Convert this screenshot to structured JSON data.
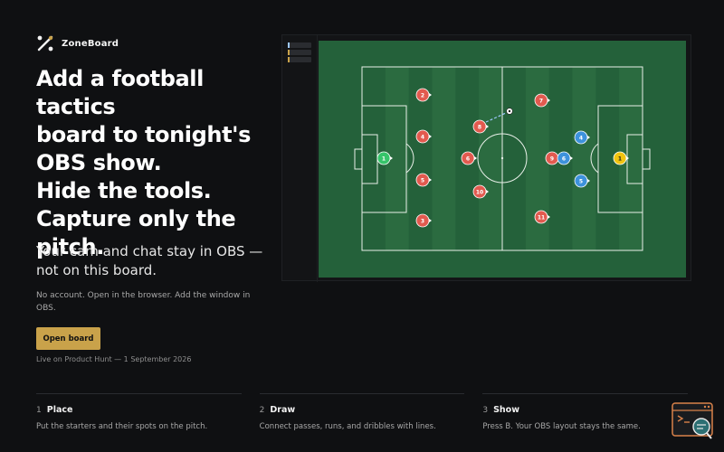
{
  "brand": {
    "name": "ZoneBoard",
    "logo_icon": "zone-logo-icon"
  },
  "hero": {
    "title_lines": [
      "Add a football tactics",
      "board to tonight's",
      "OBS show.",
      "Hide the tools.",
      "Capture only the",
      "pitch."
    ],
    "subtitle": "Your cam and chat stay in OBS — not on this board.",
    "note": "No account. Open in the browser. Add the window in OBS.",
    "cta_label": "Open board",
    "launch_text": "Live on Product Hunt — 1 September 2026"
  },
  "board": {
    "tools": [
      {
        "name": "tool-1",
        "accent": "#9ec9ff"
      },
      {
        "name": "tool-2",
        "accent": "#c9a24a"
      },
      {
        "name": "tool-3",
        "accent": "#c9a24a"
      }
    ],
    "colors": {
      "pitch": "#24613a",
      "stripe": "#2b6b40",
      "line": "#e8efe8",
      "red": "#e25a4f",
      "blue": "#3d92dc",
      "green": "#36c46a",
      "yellow": "#f1c40f"
    },
    "players": [
      {
        "label": "1",
        "team": "green"
      },
      {
        "label": "2",
        "team": "red"
      },
      {
        "label": "4",
        "team": "red"
      },
      {
        "label": "5",
        "team": "red"
      },
      {
        "label": "3",
        "team": "red"
      },
      {
        "label": "8",
        "team": "red"
      },
      {
        "label": "6",
        "team": "red"
      },
      {
        "label": "10",
        "team": "red"
      },
      {
        "label": "7",
        "team": "red"
      },
      {
        "label": "9",
        "team": "red"
      },
      {
        "label": "11",
        "team": "red"
      },
      {
        "label": "4",
        "team": "blue"
      },
      {
        "label": "6",
        "team": "blue"
      },
      {
        "label": "5",
        "team": "blue"
      },
      {
        "label": "1",
        "team": "yellow"
      }
    ]
  },
  "steps": [
    {
      "num": "1",
      "title": "Place",
      "text": "Put the starters and their spots on the pitch."
    },
    {
      "num": "2",
      "title": "Draw",
      "text": "Connect passes, runs, and dribbles with lines."
    },
    {
      "num": "3",
      "title": "Show",
      "text": "Press B. Your OBS layout stays the same."
    }
  ],
  "help_widget": {
    "icon": "support-chat-icon"
  }
}
